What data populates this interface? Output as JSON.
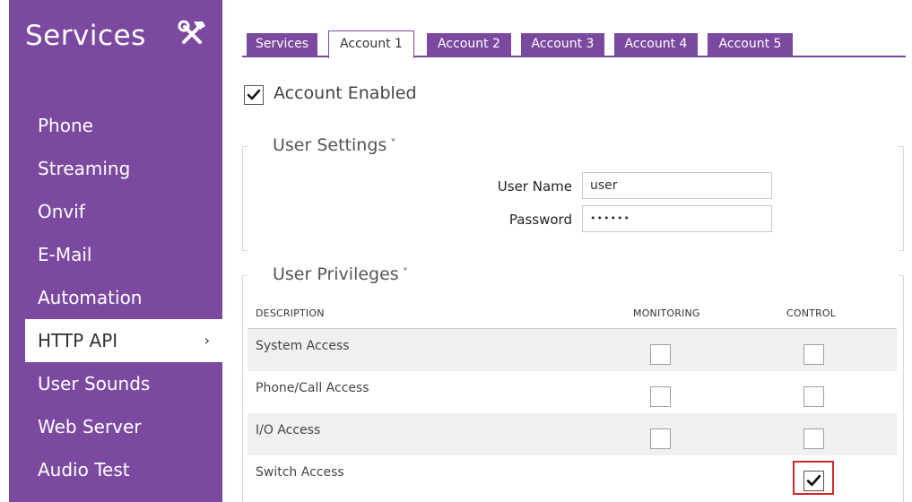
{
  "sidebar": {
    "title": "Services",
    "icon": "tools-icon",
    "items": [
      {
        "label": "Phone",
        "active": false
      },
      {
        "label": "Streaming",
        "active": false
      },
      {
        "label": "Onvif",
        "active": false
      },
      {
        "label": "E-Mail",
        "active": false
      },
      {
        "label": "Automation",
        "active": false
      },
      {
        "label": "HTTP API",
        "active": true
      },
      {
        "label": "User Sounds",
        "active": false
      },
      {
        "label": "Web Server",
        "active": false
      },
      {
        "label": "Audio Test",
        "active": false
      }
    ],
    "active_chevron": "›"
  },
  "tabs": [
    {
      "label": "Services",
      "active": false
    },
    {
      "label": "Account 1",
      "active": true
    },
    {
      "label": "Account 2",
      "active": false
    },
    {
      "label": "Account 3",
      "active": false
    },
    {
      "label": "Account 4",
      "active": false
    },
    {
      "label": "Account 5",
      "active": false
    }
  ],
  "account": {
    "enabled_label": "Account Enabled",
    "enabled": true
  },
  "user_settings": {
    "title": "User Settings",
    "caret": "˅",
    "username_label": "User Name",
    "username_value": "user",
    "password_label": "Password",
    "password_value": "••••••"
  },
  "privileges": {
    "title": "User Privileges",
    "caret": "˅",
    "columns": {
      "description": "DESCRIPTION",
      "monitoring": "MONITORING",
      "control": "CONTROL"
    },
    "rows": [
      {
        "label": "System Access",
        "monitoring": false,
        "control": false
      },
      {
        "label": "Phone/Call Access",
        "monitoring": false,
        "control": false
      },
      {
        "label": "I/O Access",
        "monitoring": false,
        "control": false
      },
      {
        "label": "Switch Access",
        "monitoring": null,
        "control": true
      }
    ]
  },
  "colors": {
    "accent": "#7b4aa0",
    "highlight": "#d4262b"
  }
}
